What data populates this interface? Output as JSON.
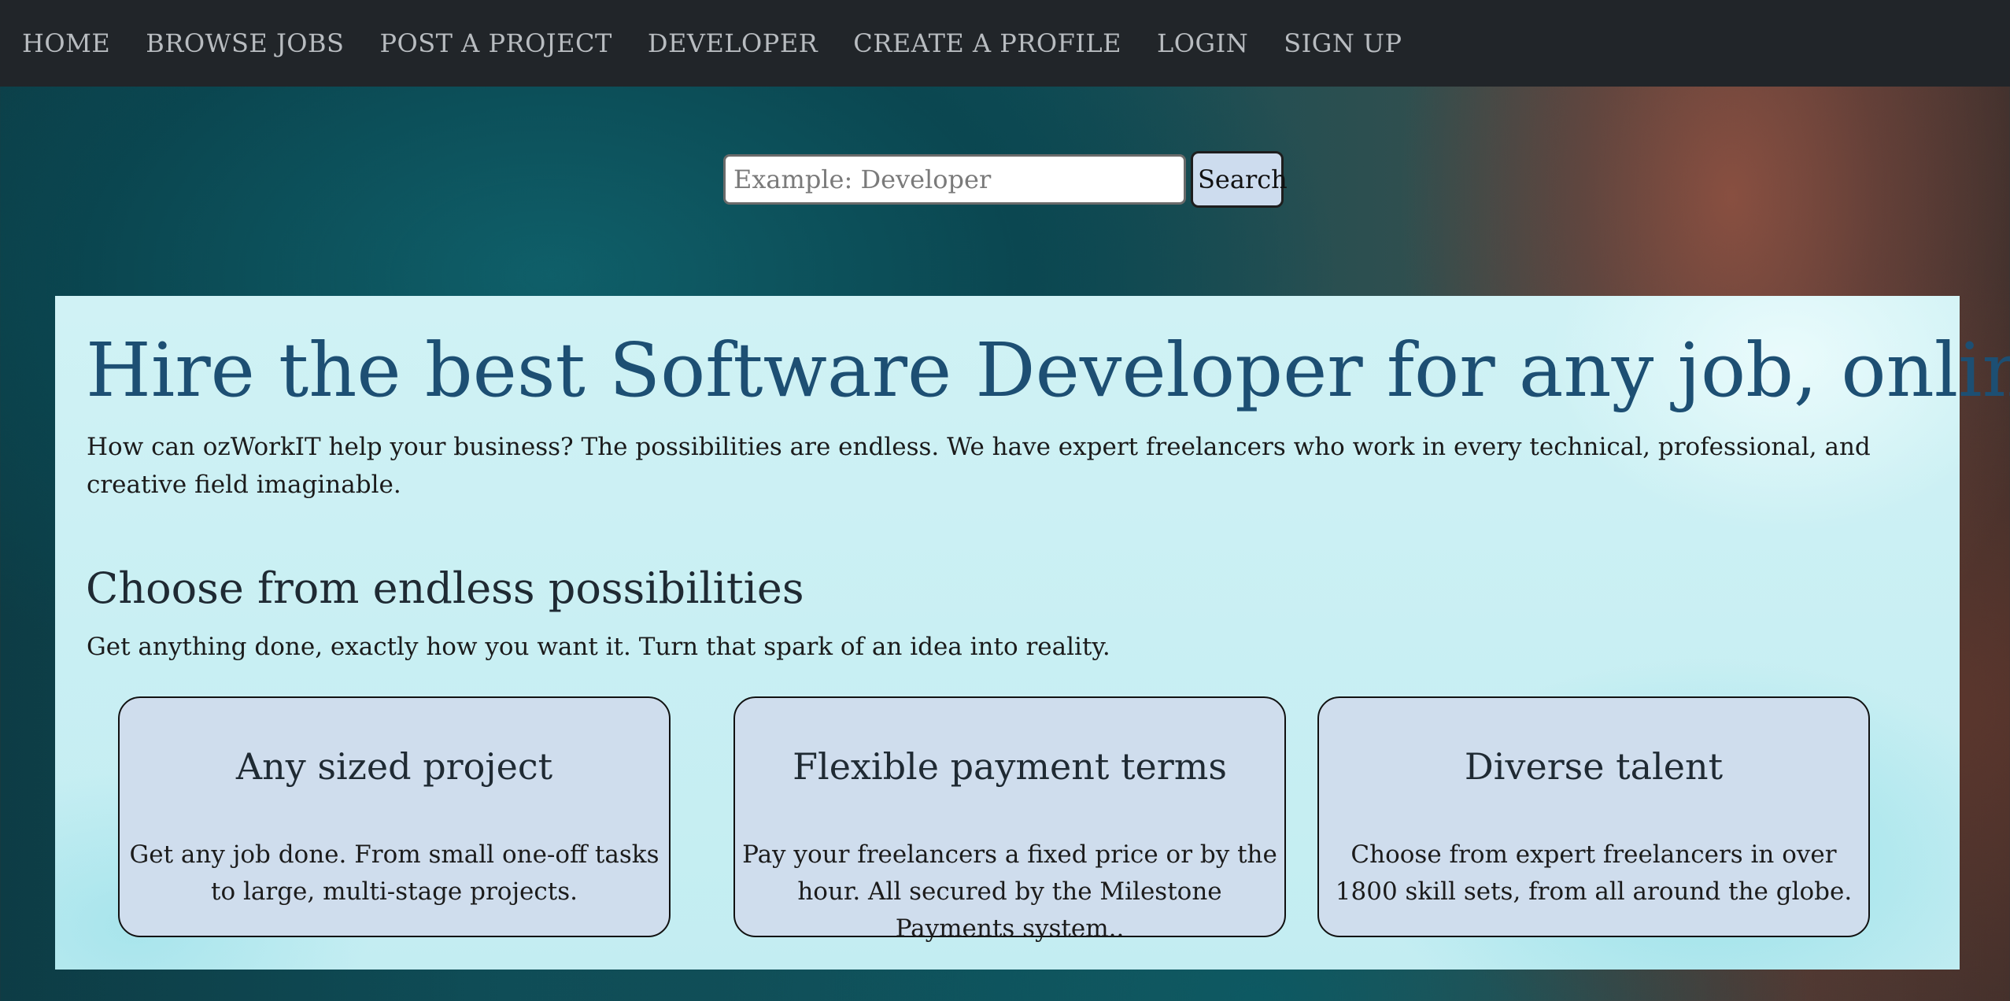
{
  "nav": {
    "items": [
      {
        "label": "HOME"
      },
      {
        "label": "BROWSE JOBS"
      },
      {
        "label": "POST A PROJECT"
      },
      {
        "label": "DEVELOPER"
      },
      {
        "label": "CREATE A PROFILE"
      },
      {
        "label": "LOGIN"
      },
      {
        "label": "SIGN UP"
      }
    ]
  },
  "search": {
    "placeholder": "Example: Developer",
    "value": "",
    "button_label": "Search"
  },
  "hero": {
    "headline": "Hire the best Software Developer for any job, online.",
    "intro": "How can ozWorkIT help your business? The possibilities are endless. We have expert freelancers who work in every technical, professional, and creative field imaginable.",
    "subheading": "Choose from endless possibilities",
    "subtext": "Get anything done, exactly how you want it. Turn that spark of an idea into reality."
  },
  "cards": [
    {
      "title": "Any sized project",
      "text": "Get any job done. From small one-off tasks to large, multi-stage projects."
    },
    {
      "title": "Flexible payment terms",
      "text": "Pay your freelancers a fixed price or by the hour. All secured by the Milestone Payments system.."
    },
    {
      "title": "Diverse talent",
      "text": "Choose from expert freelancers in over 1800 skill sets, from all around the globe."
    }
  ],
  "colors": {
    "navbar_bg": "#212529",
    "nav_text": "#b8bcc0",
    "headline": "#1d4f73",
    "card_bg": "#cfdded",
    "search_button_bg": "#cddcee"
  }
}
